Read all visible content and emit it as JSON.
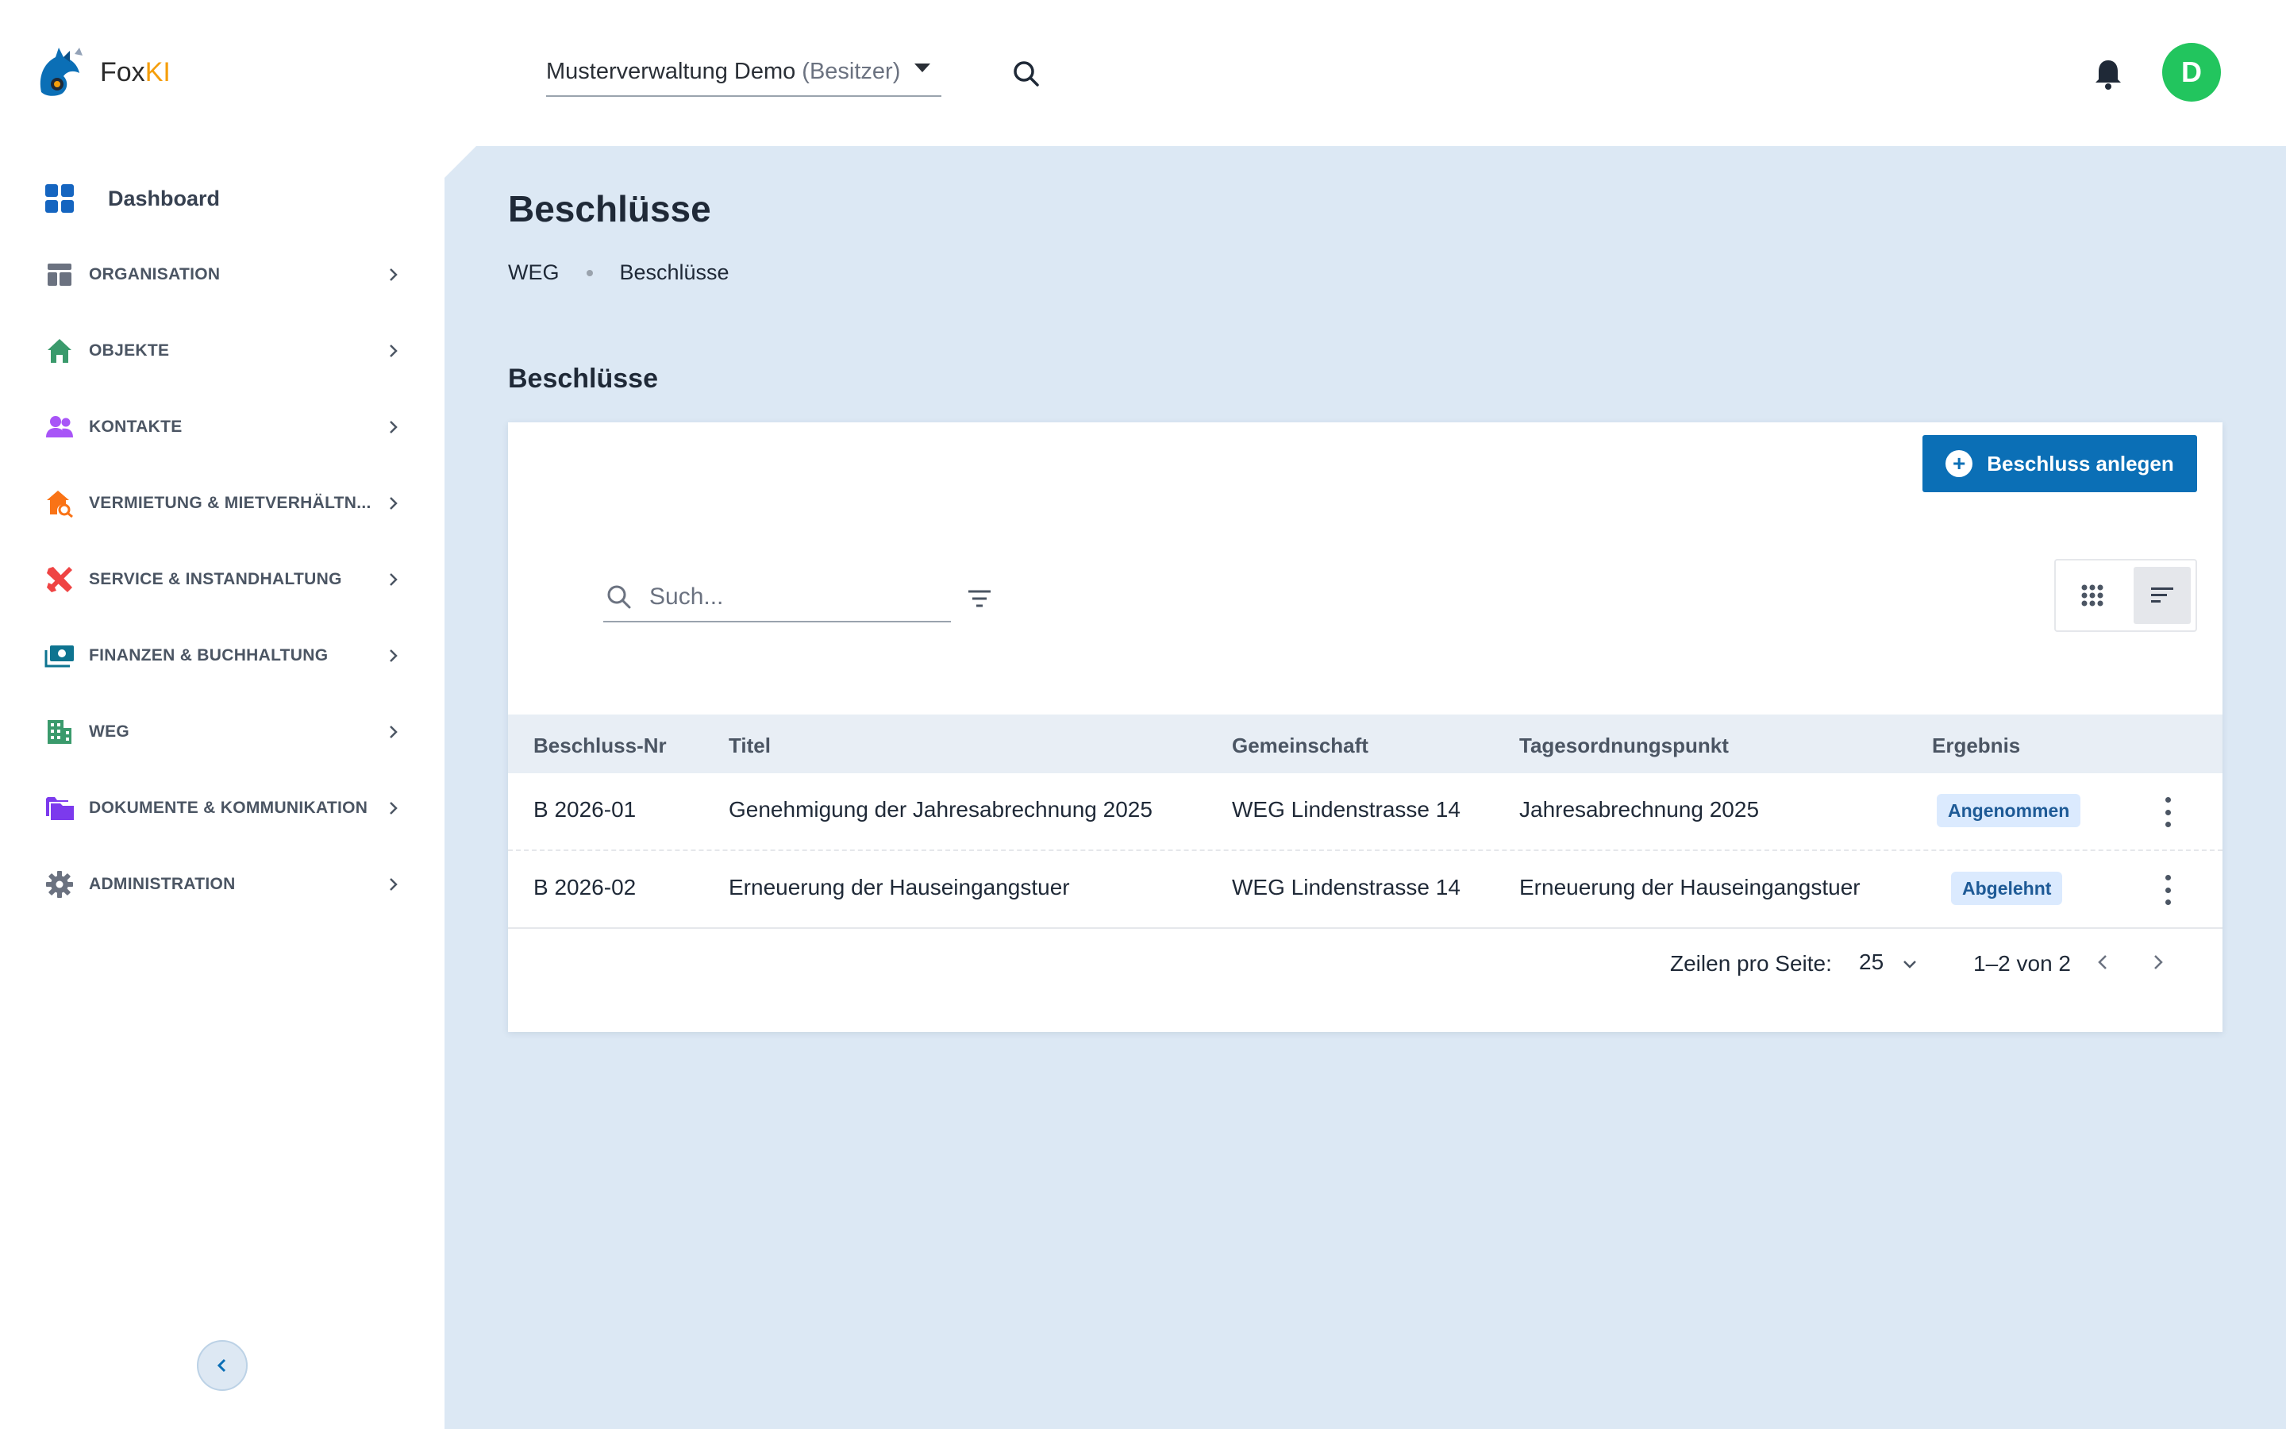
{
  "app": {
    "logo_text_main": "Fox",
    "logo_text_accent": "KI"
  },
  "header": {
    "org_name": "Musterverwaltung Demo",
    "org_role": "(Besitzer)",
    "avatar_initial": "D",
    "avatar_color": "#22c55e"
  },
  "sidebar": {
    "dashboard": "Dashboard",
    "items": [
      {
        "label": "ORGANISATION",
        "icon": "organisation-icon",
        "color": "#6b7280"
      },
      {
        "label": "OBJEKTE",
        "icon": "home-icon",
        "color": "#3a9a6c"
      },
      {
        "label": "KONTAKTE",
        "icon": "people-icon",
        "color": "#a855f7"
      },
      {
        "label": "VERMIETUNG & MIETVERHÄLTN...",
        "icon": "house-search-icon",
        "color": "#f97316"
      },
      {
        "label": "SERVICE & INSTANDHALTUNG",
        "icon": "tools-icon",
        "color": "#ef4444"
      },
      {
        "label": "FINANZEN & BUCHHALTUNG",
        "icon": "money-icon",
        "color": "#0e7490"
      },
      {
        "label": "WEG",
        "icon": "building-icon",
        "color": "#3a9a6c"
      },
      {
        "label": "DOKUMENTE & KOMMUNIKATION",
        "icon": "folder-icon",
        "color": "#7c3aed"
      },
      {
        "label": "ADMINISTRATION",
        "icon": "gear-icon",
        "color": "#6b7280"
      }
    ]
  },
  "page": {
    "title": "Beschlüsse",
    "breadcrumb": [
      "WEG",
      "Beschlüsse"
    ],
    "section_title": "Beschlüsse",
    "add_button": "Beschluss anlegen",
    "search_placeholder": "Such..."
  },
  "table": {
    "columns": [
      "Beschluss-Nr",
      "Titel",
      "Gemeinschaft",
      "Tagesordnungspunkt",
      "Ergebnis"
    ],
    "rows": [
      {
        "nr": "B 2026-01",
        "titel": "Genehmigung der Jahresabrechnung 2025",
        "gemeinschaft": "WEG Lindenstrasse 14",
        "top": "Jahresabrechnung 2025",
        "ergebnis": "Angenommen"
      },
      {
        "nr": "B 2026-02",
        "titel": "Erneuerung der Hauseingangstuer",
        "gemeinschaft": "WEG Lindenstrasse 14",
        "top": "Erneuerung der Hauseingangstuer",
        "ergebnis": "Abgelehnt"
      }
    ]
  },
  "pager": {
    "rows_label": "Zeilen pro Seite:",
    "rows_value": "25",
    "range": "1–2 von 2"
  },
  "colors": {
    "primary": "#0b6fb6",
    "main_bg": "#dce8f4",
    "badge_bg": "#dbeafe"
  }
}
